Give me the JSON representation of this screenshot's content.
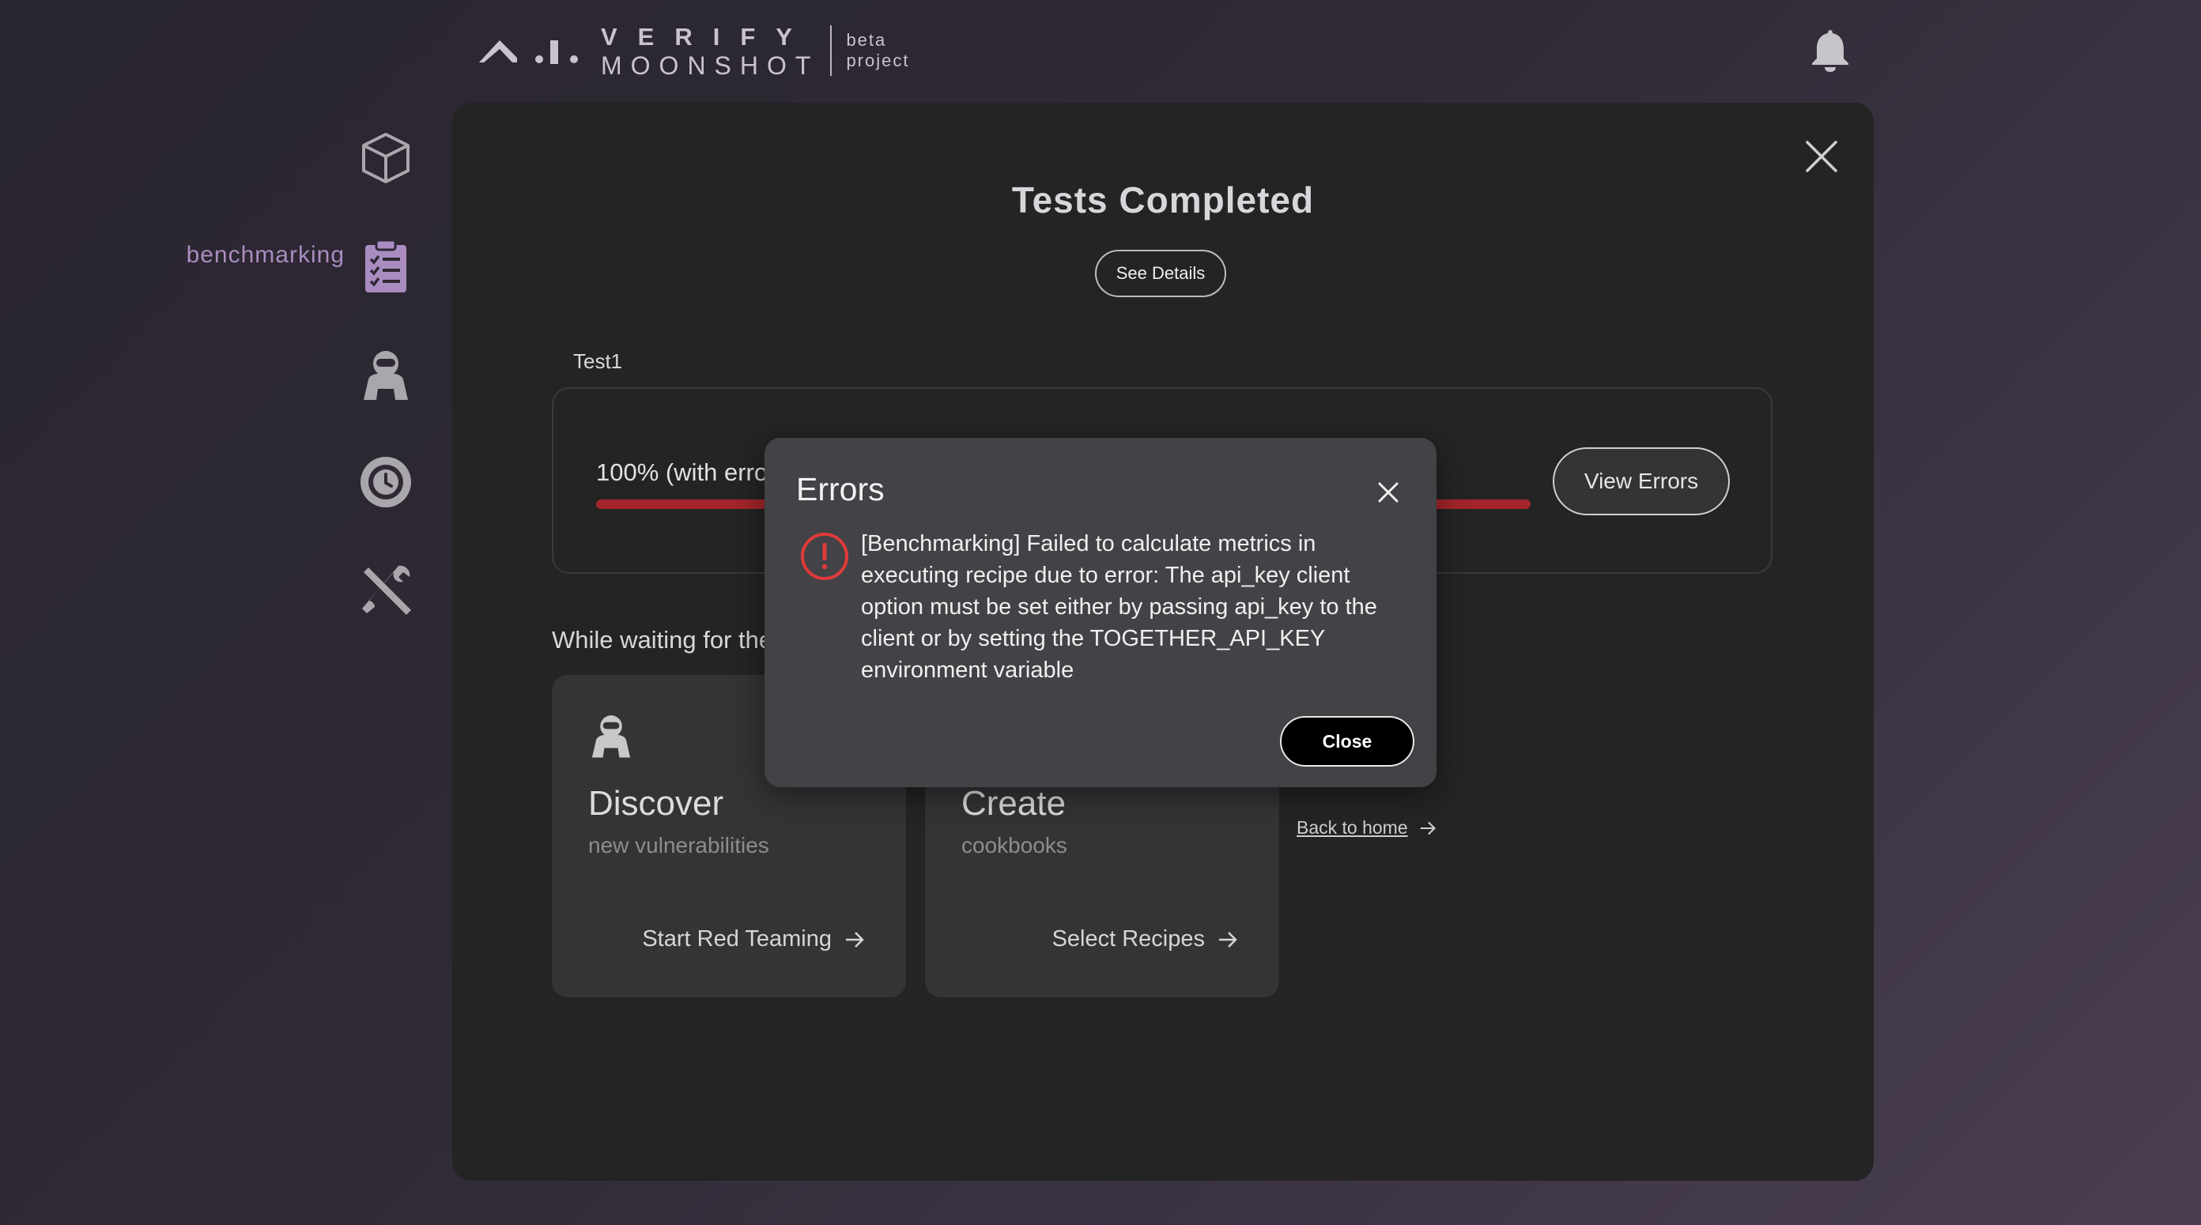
{
  "header": {
    "logo_line1": "VERIFY",
    "logo_line2": "MOONSHOT",
    "logo_tag1": "beta",
    "logo_tag2": "project",
    "bell_icon": "bell-icon"
  },
  "sidebar": {
    "items": [
      {
        "icon": "cube-icon",
        "label": ""
      },
      {
        "icon": "clipboard-checklist-icon",
        "label": "benchmarking"
      },
      {
        "icon": "red-teaming-agent-icon",
        "label": ""
      },
      {
        "icon": "history-clock-icon",
        "label": ""
      },
      {
        "icon": "tools-icon",
        "label": ""
      }
    ],
    "active_color": "#a98cc0"
  },
  "panel": {
    "title": "Tests Completed",
    "see_details_label": "See Details",
    "test_name": "Test1",
    "progress_text": "100% (with errors)",
    "progress_percent": 100,
    "progress_color": "#a3252a",
    "view_errors_label": "View Errors",
    "waiting_text": "While waiting for the test to complete, here are some things you can do",
    "cards": [
      {
        "icon": "red-teaming-agent-icon",
        "title": "Discover",
        "subtitle": "new vulnerabilities",
        "action": "Start Red Teaming"
      },
      {
        "icon": "cookbook-icon",
        "title": "Create",
        "subtitle": "cookbooks",
        "action": "Select Recipes"
      }
    ],
    "back_home_label": "Back to home"
  },
  "modal": {
    "title": "Errors",
    "message": "[Benchmarking] Failed to calculate metrics in executing recipe due to error: The api_key client option must be set either by passing api_key to the client or by setting the TOGETHER_API_KEY environment variable",
    "close_label": "Close",
    "error_color": "#e03a3a"
  }
}
